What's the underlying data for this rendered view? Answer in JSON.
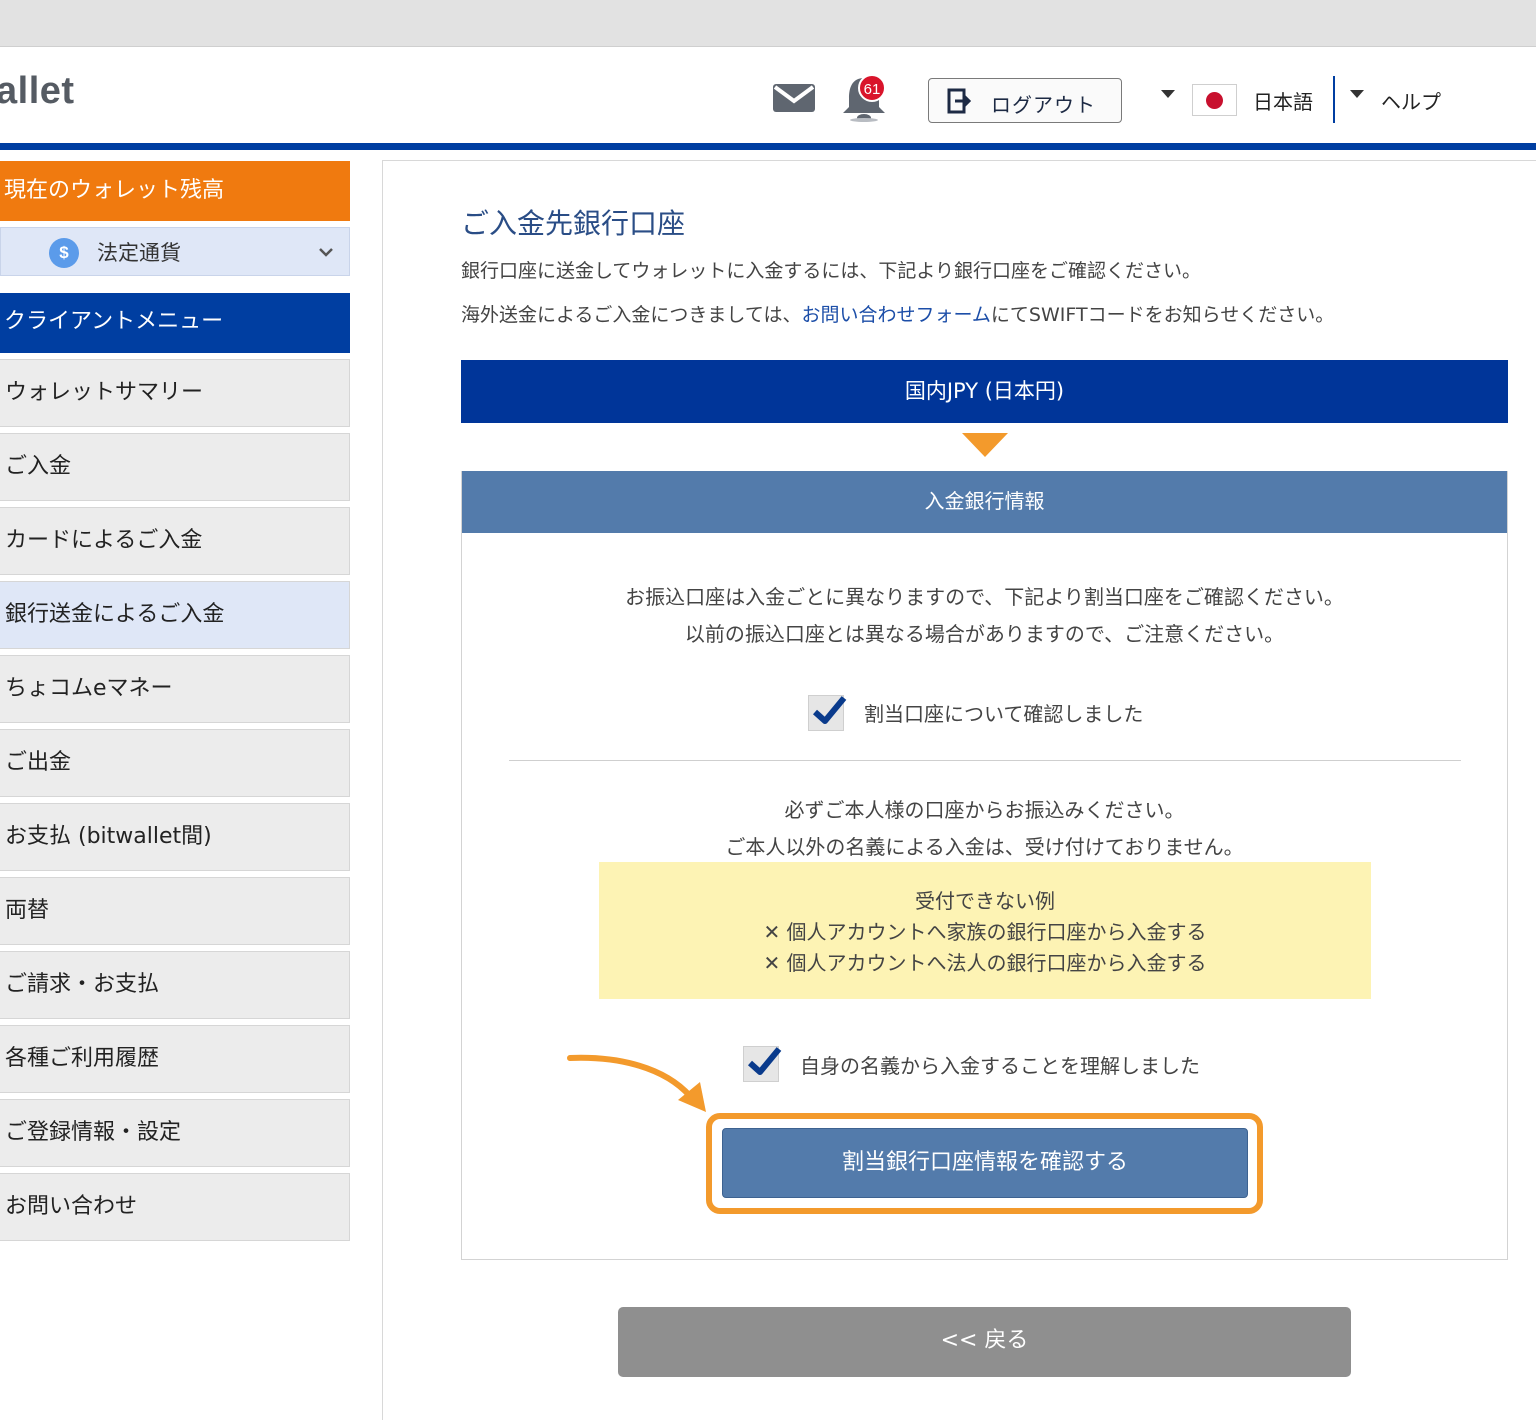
{
  "header": {
    "logo_text": "allet",
    "notification_count": "61",
    "logout_label": "ログアウト",
    "language_label": "日本語",
    "help_label": "ヘルプ"
  },
  "sidebar": {
    "wallet_balance_label": "現在のウォレット残高",
    "fiat_label": "法定通貨",
    "fiat_coin_symbol": "$",
    "client_menu_label": "クライアントメニュー",
    "items": [
      {
        "label": "ウォレットサマリー"
      },
      {
        "label": "ご入金"
      },
      {
        "label": "カードによるご入金"
      },
      {
        "label": "銀行送金によるご入金",
        "active": true
      },
      {
        "label": "ちょコムeマネー"
      },
      {
        "label": "ご出金"
      },
      {
        "label": "お支払 (bitwallet間)"
      },
      {
        "label": "両替"
      },
      {
        "label": "ご請求・お支払"
      },
      {
        "label": "各種ご利用履歴"
      },
      {
        "label": "ご登録情報・設定"
      },
      {
        "label": "お問い合わせ"
      }
    ]
  },
  "main": {
    "title": "ご入金先銀行口座",
    "intro_line1": "銀行口座に送金してウォレットに入金するには、下記より銀行口座をご確認ください。",
    "intro_line2_prefix": "海外送金によるご入金につきましては、",
    "intro_line2_link": "お問い合わせフォーム",
    "intro_line2_suffix": "にてSWIFTコードをお知らせください。",
    "currency_bar": "国内JPY (日本円)",
    "info_header": "入金銀行情報",
    "notice1_line1": "お振込口座は入金ごとに異なりますので、下記より割当口座をご確認ください。",
    "notice1_line2": "以前の振込口座とは異なる場合がありますので、ご注意ください。",
    "checkbox1_label": "割当口座について確認しました",
    "notice2_line1": "必ずご本人様の口座からお振込みください。",
    "notice2_line2": "ご本人以外の名義による入金は、受け付けておりません。",
    "warning_title": "受付できない例",
    "warning_items": [
      "✕ 個人アカウントへ家族の銀行口座から入金する",
      "✕ 個人アカウントへ法人の銀行口座から入金する"
    ],
    "checkbox2_label": "自身の名義から入金することを理解しました",
    "confirm_button": "割当銀行口座情報を確認する",
    "back_button": "<< 戻る"
  },
  "colors": {
    "brand_blue": "#003ea1",
    "accent_orange": "#f07a0f",
    "highlight_orange": "#f39a2c",
    "section_blue": "#537bab",
    "warning_yellow": "#fdf3b4"
  }
}
